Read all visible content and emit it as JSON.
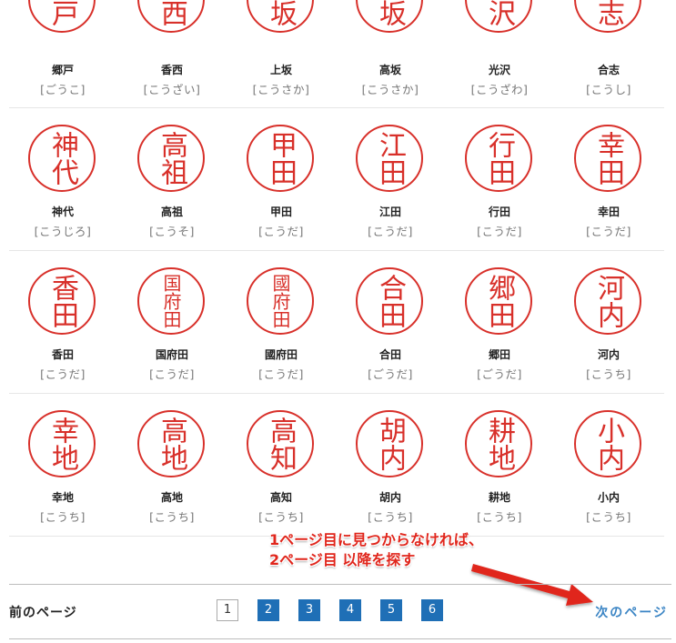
{
  "rows": [
    [
      {
        "stamp": "郷戸",
        "name": "郷戸",
        "reading": "[ごうこ]"
      },
      {
        "stamp": "香西",
        "name": "香西",
        "reading": "[こうざい]"
      },
      {
        "stamp": "上坂",
        "name": "上坂",
        "reading": "[こうさか]"
      },
      {
        "stamp": "高坂",
        "name": "高坂",
        "reading": "[こうさか]"
      },
      {
        "stamp": "光沢",
        "name": "光沢",
        "reading": "[こうざわ]"
      },
      {
        "stamp": "合志",
        "name": "合志",
        "reading": "[こうし]"
      }
    ],
    [
      {
        "stamp": "神代",
        "name": "神代",
        "reading": "[こうじろ]"
      },
      {
        "stamp": "高祖",
        "name": "高祖",
        "reading": "[こうそ]"
      },
      {
        "stamp": "甲田",
        "name": "甲田",
        "reading": "[こうだ]"
      },
      {
        "stamp": "江田",
        "name": "江田",
        "reading": "[こうだ]"
      },
      {
        "stamp": "行田",
        "name": "行田",
        "reading": "[こうだ]"
      },
      {
        "stamp": "幸田",
        "name": "幸田",
        "reading": "[こうだ]"
      }
    ],
    [
      {
        "stamp": "香田",
        "name": "香田",
        "reading": "[こうだ]"
      },
      {
        "stamp": "国府田",
        "name": "国府田",
        "reading": "[こうだ]"
      },
      {
        "stamp": "國府田",
        "name": "國府田",
        "reading": "[こうだ]"
      },
      {
        "stamp": "合田",
        "name": "合田",
        "reading": "[ごうだ]"
      },
      {
        "stamp": "郷田",
        "name": "郷田",
        "reading": "[ごうだ]"
      },
      {
        "stamp": "河内",
        "name": "河内",
        "reading": "[こうち]"
      }
    ],
    [
      {
        "stamp": "幸地",
        "name": "幸地",
        "reading": "[こうち]"
      },
      {
        "stamp": "高地",
        "name": "高地",
        "reading": "[こうち]"
      },
      {
        "stamp": "高知",
        "name": "高知",
        "reading": "[こうち]"
      },
      {
        "stamp": "胡内",
        "name": "胡内",
        "reading": "[こうち]"
      },
      {
        "stamp": "耕地",
        "name": "耕地",
        "reading": "[こうち]"
      },
      {
        "stamp": "小内",
        "name": "小内",
        "reading": "[こうち]"
      }
    ]
  ],
  "annotation": {
    "line1": "1ページ目に見つからなければ、",
    "line2": "2ページ目 以降を探す"
  },
  "pagination": {
    "prev_label": "前のページ",
    "next_label": "次のページ",
    "pages": [
      "1",
      "2",
      "3",
      "4",
      "5",
      "6"
    ],
    "current": "1"
  },
  "colors": {
    "stamp_red": "#d8302a",
    "link_blue": "#1f6fb6",
    "annotation_red": "#e0261c"
  }
}
